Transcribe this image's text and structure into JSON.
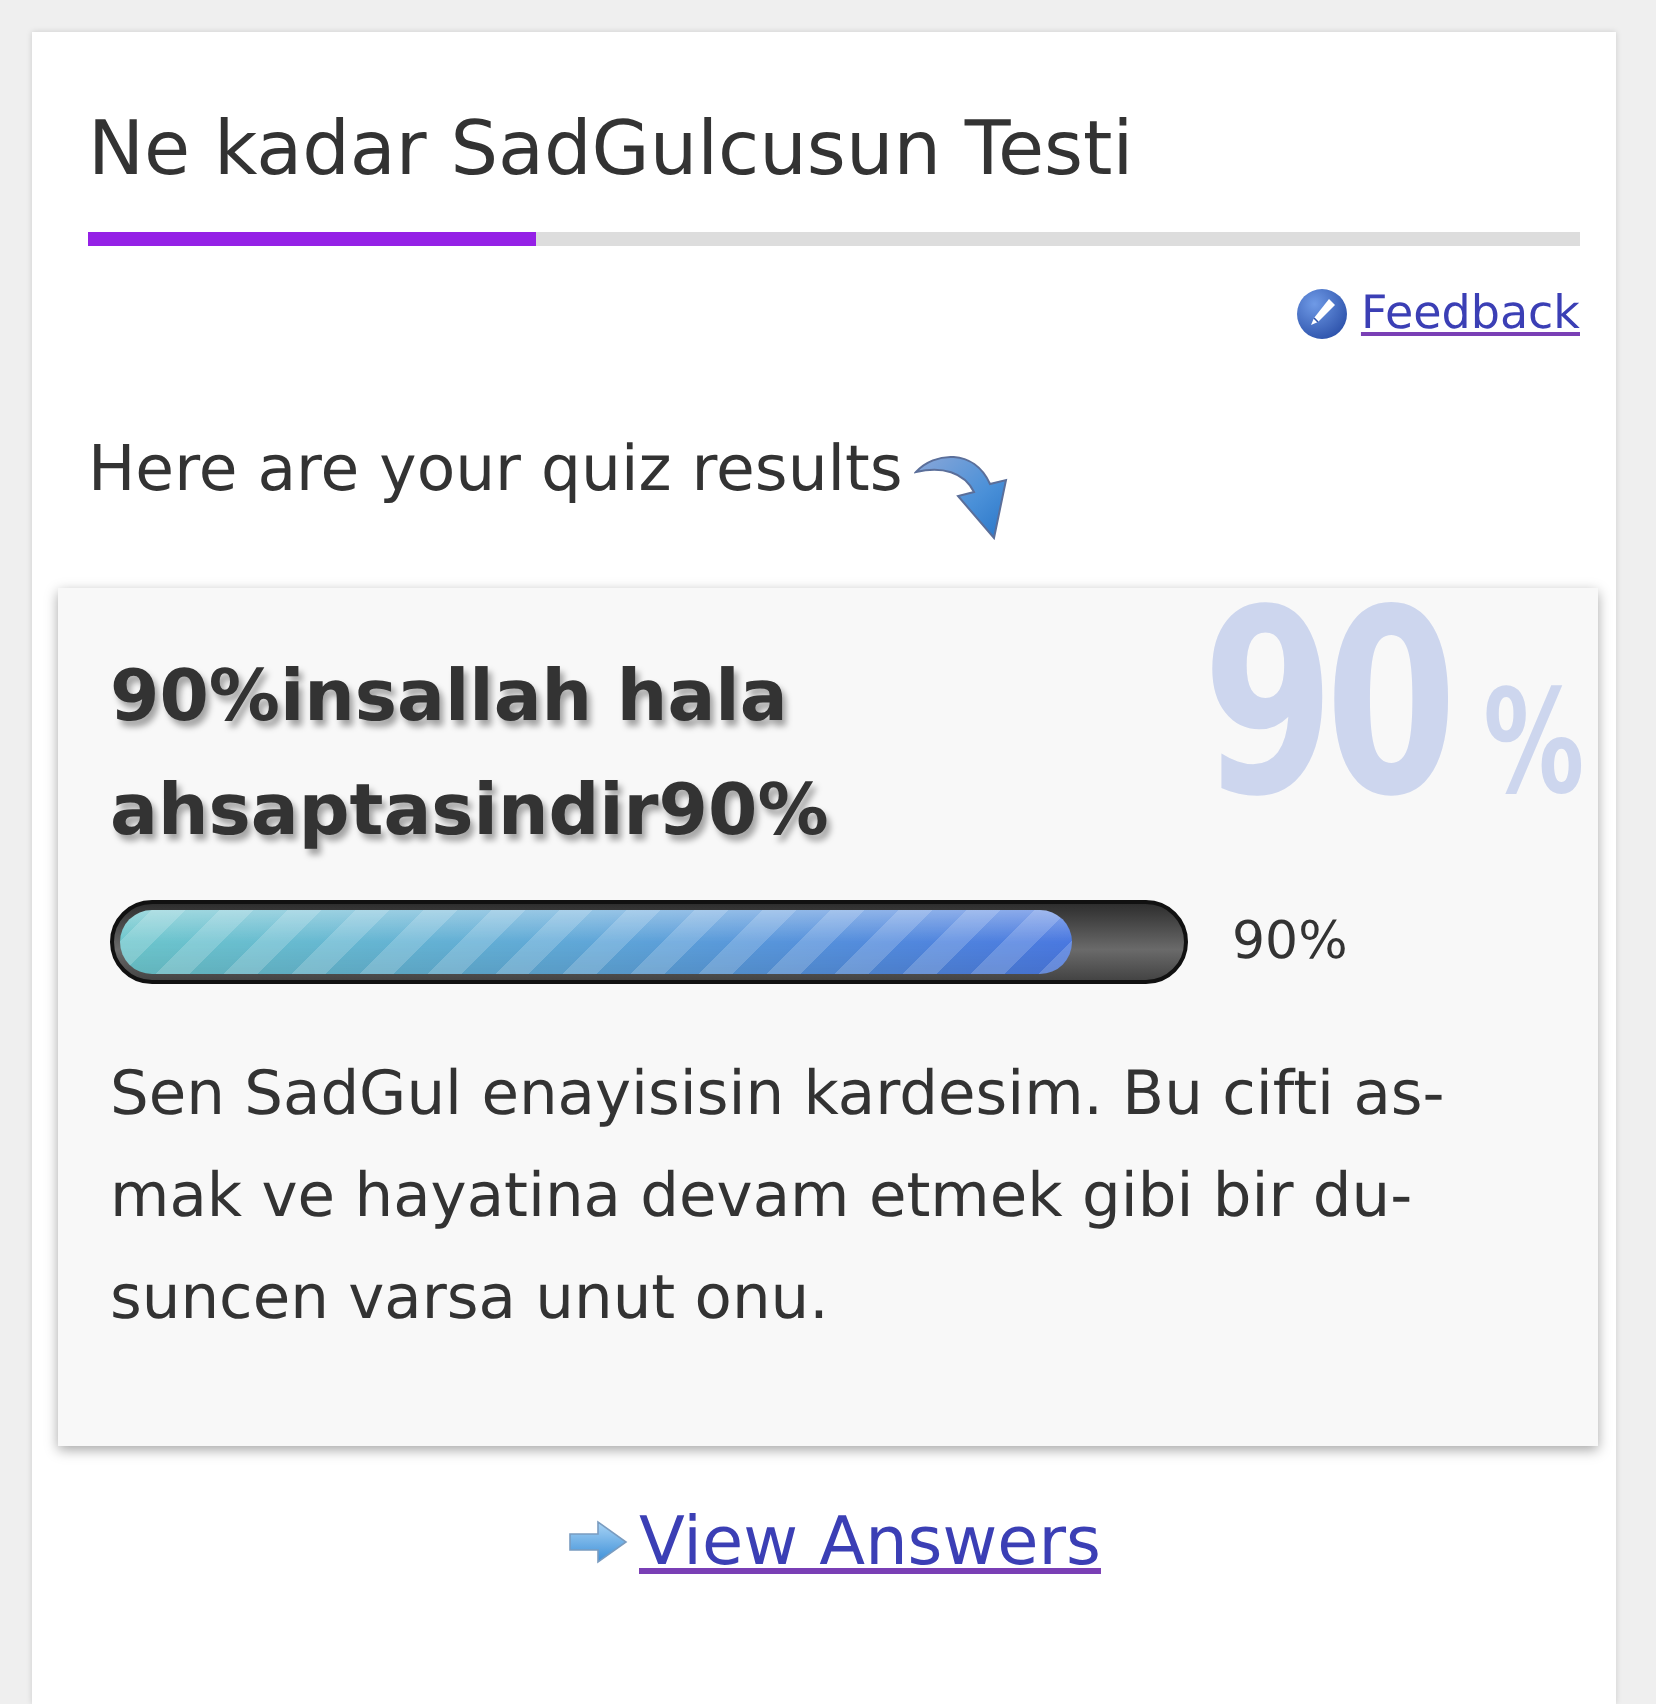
{
  "quiz": {
    "title": "Ne kadar SadGulcusun Testi",
    "progress": {
      "level": 0.3
    }
  },
  "feedback_link": "Feedback",
  "intro": "Here are your quiz results",
  "result": {
    "watermark": {
      "number": "90",
      "unit": "%"
    },
    "title": "90%insallah hala ahsaptasindir90%",
    "score": {
      "level": 0.9,
      "reading": "90%"
    },
    "description_lines": [
      "Sen SadGul enayisisin kardesim. Bu cifti as-",
      "mak ve hayatina devam etmek gibi bir du-",
      "suncen varsa unut onu."
    ]
  },
  "view_answers_link": "View Answers"
}
